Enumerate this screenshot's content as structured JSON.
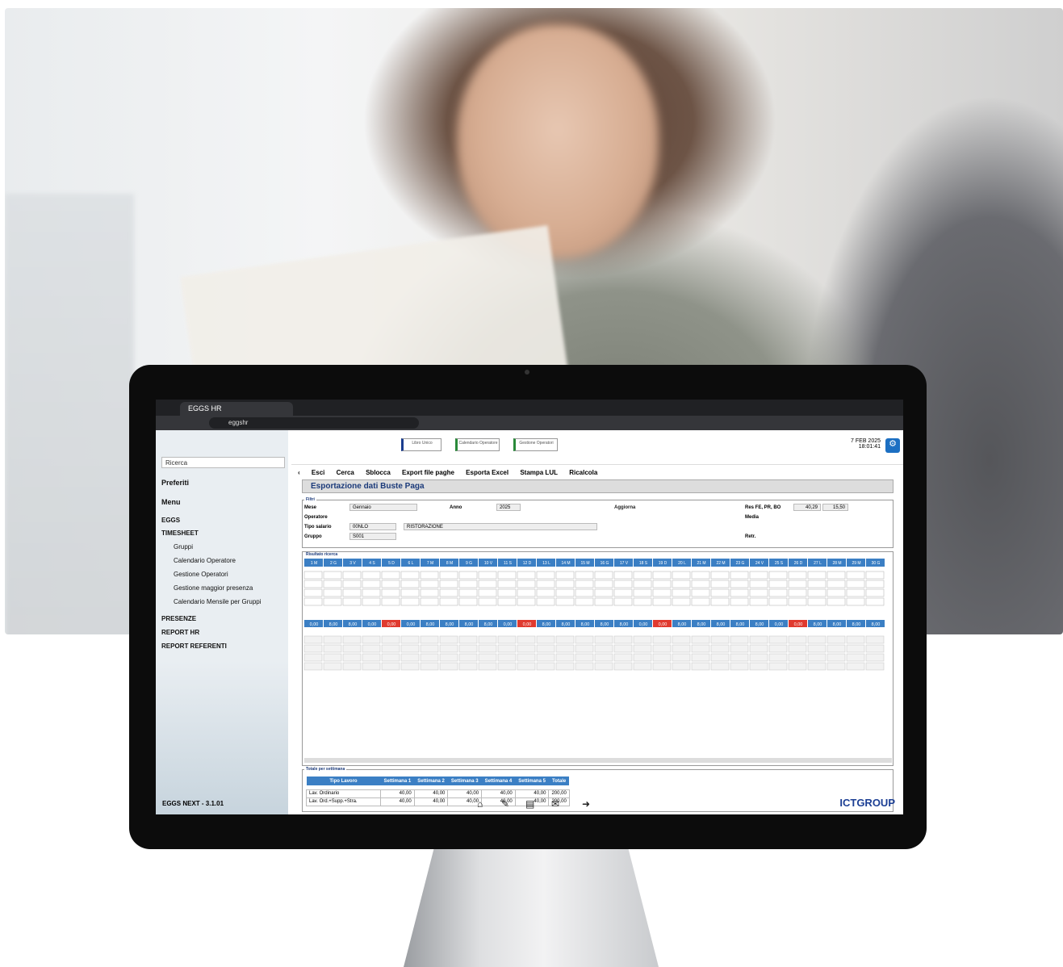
{
  "browser": {
    "tab_title": "EGGS HR",
    "url": "eggshr"
  },
  "sidebar": {
    "search_placeholder": "Ricerca",
    "favorites": "Preferiti",
    "menu": "Menu",
    "items": [
      "EGGS",
      "TIMESHEET",
      "Gruppi",
      "Calendario Operatore",
      "Gestione Operatori",
      "Gestione maggior presenza",
      "Calendario Mensile per Gruppi",
      "PRESENZE",
      "REPORT HR",
      "REPORT REFERENTI"
    ],
    "version": "EGGS NEXT - 3.1.01"
  },
  "quick": [
    "Libro Unico",
    "Calendario Operatore",
    "Gestione Operatori"
  ],
  "clock": {
    "date": "7 FEB 2025",
    "time": "18:01:41"
  },
  "notifications": "0",
  "toolbar": [
    "Esci",
    "Cerca",
    "Sblocca",
    "Export file paghe",
    "Esporta Excel",
    "Stampa LUL",
    "Ricalcola"
  ],
  "page_title": "Esportazione dati Buste Paga",
  "filters": {
    "legend": "Filtri",
    "mese_label": "Mese",
    "mese": "Gennaio",
    "anno_label": "Anno",
    "anno": "2025",
    "operatore_label": "Operatore",
    "tipo_label": "Tipo salario",
    "tipo": "00NLO",
    "tipo_desc": "RISTORAZIONE",
    "gruppo_label": "Gruppo",
    "gruppo": "S001",
    "aggiorna": "Aggiorna",
    "res_label": "Res FE, PR, BO",
    "res1": "40,29",
    "res2": "15,50",
    "media_label": "Media",
    "retr_label": "Retr."
  },
  "results": {
    "legend": "Risultato ricerca",
    "days": [
      "1 M",
      "2 G",
      "3 V",
      "4 S",
      "5 D",
      "6 L",
      "7 M",
      "8 M",
      "9 G",
      "10 V",
      "11 S",
      "12 D",
      "13 L",
      "14 M",
      "15 M",
      "16 G",
      "17 V",
      "18 S",
      "19 D",
      "20 L",
      "21 M",
      "22 M",
      "23 G",
      "24 V",
      "25 S",
      "26 D",
      "27 L",
      "28 M",
      "29 M",
      "30 G"
    ],
    "total_row": [
      "0,00",
      "8,00",
      "8,00",
      "0,00",
      "0,00",
      "0,00",
      "8,00",
      "8,00",
      "8,00",
      "8,00",
      "0,00",
      "0,00",
      "8,00",
      "8,00",
      "8,00",
      "8,00",
      "8,00",
      "0,00",
      "0,00",
      "8,00",
      "8,00",
      "8,00",
      "8,00",
      "8,00",
      "0,00",
      "0,00",
      "8,00",
      "8,00",
      "8,00",
      "8,00"
    ]
  },
  "weekly": {
    "legend": "Totale per settimana",
    "headers": [
      "Tipo Lavoro",
      "Settimana 1",
      "Settimana 2",
      "Settimana 3",
      "Settimana 4",
      "Settimana 5",
      "Totale"
    ],
    "rows": [
      [
        "Lav. Ordinario",
        "40,00",
        "40,00",
        "40,00",
        "40,00",
        "40,00",
        "200,00"
      ],
      [
        "Lav. Ord.+Supp.+Stra.",
        "40,00",
        "40,00",
        "40,00",
        "40,00",
        "40,00",
        "200,00"
      ]
    ]
  },
  "brand": "ICTGROUP"
}
